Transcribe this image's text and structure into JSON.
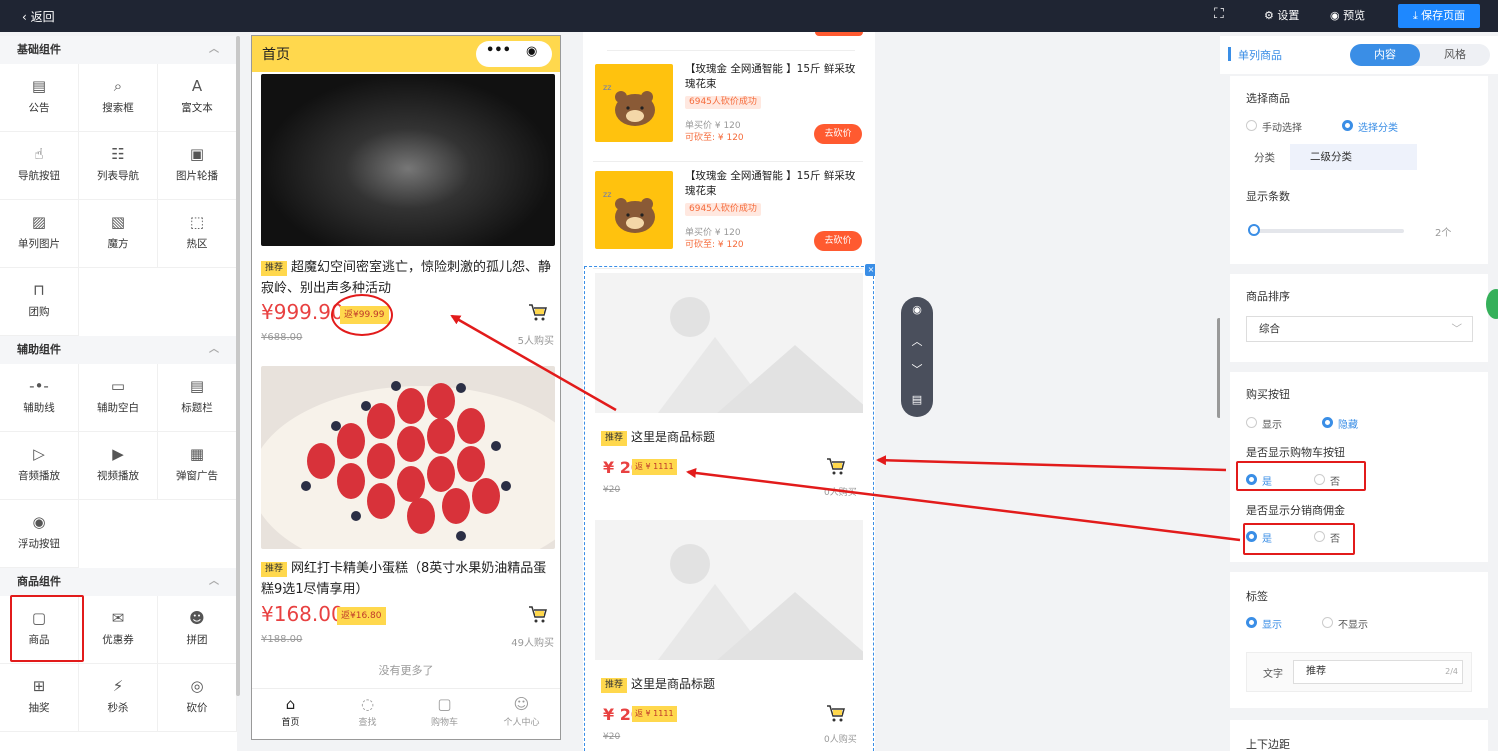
{
  "topbar": {
    "back_label": "返回",
    "settings_label": "设置",
    "preview_label": "预览",
    "save_label": "保存页面"
  },
  "left": {
    "groups": [
      {
        "title": "基础组件",
        "items": [
          {
            "label": "公告",
            "icon": "notice-icon"
          },
          {
            "label": "搜索框",
            "icon": "search-icon"
          },
          {
            "label": "富文本",
            "icon": "rich-text-icon"
          },
          {
            "label": "导航按钮",
            "icon": "hand-pointer-icon"
          },
          {
            "label": "列表导航",
            "icon": "list-icon"
          },
          {
            "label": "图片轮播",
            "icon": "image-carousel-icon"
          },
          {
            "label": "单列图片",
            "icon": "image-icon"
          },
          {
            "label": "魔方",
            "icon": "cube-icon"
          },
          {
            "label": "热区",
            "icon": "hotspot-icon"
          },
          {
            "label": "团购",
            "icon": "bag-icon"
          }
        ]
      },
      {
        "title": "辅助组件",
        "items": [
          {
            "label": "辅助线",
            "icon": "divider-icon"
          },
          {
            "label": "辅助空白",
            "icon": "blank-icon"
          },
          {
            "label": "标题栏",
            "icon": "title-bar-icon"
          },
          {
            "label": "音频播放",
            "icon": "audio-icon"
          },
          {
            "label": "视频播放",
            "icon": "video-icon"
          },
          {
            "label": "弹窗广告",
            "icon": "popup-ad-icon"
          },
          {
            "label": "浮动按钮",
            "icon": "float-button-icon"
          }
        ]
      },
      {
        "title": "商品组件",
        "items": [
          {
            "label": "商品",
            "icon": "goods-icon"
          },
          {
            "label": "优惠券",
            "icon": "coupon-icon"
          },
          {
            "label": "拼团",
            "icon": "group-buy-icon"
          },
          {
            "label": "抽奖",
            "icon": "lottery-icon"
          },
          {
            "label": "秒杀",
            "icon": "flash-sale-icon"
          },
          {
            "label": "砍价",
            "icon": "bargain-icon"
          }
        ]
      }
    ]
  },
  "phone": {
    "title": "首页",
    "capsule_dots": "•••",
    "products": [
      {
        "tag": "推荐",
        "title": "超魔幻空间密室逃亡，惊险刺激的孤儿怨、静寂岭、别出声多种活动",
        "price": "¥999.90",
        "rebate": "返¥99.99",
        "orig_price": "¥688.00",
        "sold": "5人购买"
      },
      {
        "tag": "推荐",
        "title": "网红打卡精美小蛋糕（8英寸水果奶油精品蛋糕9选1尽情享用）",
        "price": "¥168.00",
        "rebate": "返¥16.80",
        "orig_price": "¥188.00",
        "sold": "49人购买"
      }
    ],
    "no_more": "没有更多了",
    "tabs": [
      {
        "label": "首页",
        "icon": "home-icon"
      },
      {
        "label": "查找",
        "icon": "find-icon"
      },
      {
        "label": "购物车",
        "icon": "cart-icon"
      },
      {
        "label": "个人中心",
        "icon": "user-icon"
      }
    ]
  },
  "preview": {
    "bargain_items": [
      {
        "title": "【玫瑰金 全网通智能 】15斤 鲜采玫瑰花束",
        "badge": "6945人砍价成功",
        "single_price": "单买价 ¥ 120",
        "bargain_price": "可砍至: ¥ 120",
        "button": "去砍价"
      },
      {
        "title": "【玫瑰金 全网通智能 】15斤 鲜采玫瑰花束",
        "badge": "6945人砍价成功",
        "single_price": "单买价 ¥ 120",
        "bargain_price": "可砍至: ¥ 120",
        "button": "去砍价"
      }
    ],
    "goods": [
      {
        "tag": "推荐",
        "title": "这里是商品标题",
        "price": "¥ 20",
        "rebate": "返 ¥ 1111",
        "orig": "¥20",
        "sold": "0人购买"
      },
      {
        "tag": "推荐",
        "title": "这里是商品标题",
        "price": "¥ 20",
        "rebate": "返 ¥ 1111",
        "orig": "¥20",
        "sold": "0人购买"
      }
    ],
    "close": "×"
  },
  "right": {
    "component_name": "单列商品",
    "tab_content": "内容",
    "tab_style": "风格",
    "select_goods": {
      "title": "选择商品",
      "opt_manual": "手动选择",
      "opt_category": "选择分类",
      "category_label": "分类",
      "category_value": "二级分类"
    },
    "display_count": {
      "title": "显示条数",
      "value": "2个",
      "level": 0.0
    },
    "sort": {
      "title": "商品排序",
      "value": "综合"
    },
    "buy_button": {
      "title": "购买按钮",
      "opt_show": "显示",
      "opt_hide": "隐藏",
      "cart_title": "是否显示购物车按钮",
      "cart_yes": "是",
      "cart_no": "否",
      "commission_title": "是否显示分销商佣金",
      "commission_yes": "是",
      "commission_no": "否"
    },
    "label": {
      "title": "标签",
      "opt_show": "显示",
      "opt_hide": "不显示",
      "text_label": "文字",
      "text_value": "推荐",
      "text_count": "2/4"
    },
    "margin_title": "上下边距"
  },
  "colors": {
    "accent": "#3a8ee6",
    "topbar": "#1f2533",
    "phone_header": "#ffd84d",
    "price_red": "#e84141",
    "annotation_red": "#e21b1b"
  }
}
